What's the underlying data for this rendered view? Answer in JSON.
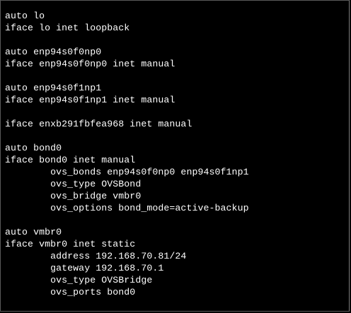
{
  "terminal": {
    "text_color": "#ffffff",
    "background_color": "#000000",
    "lines": [
      "auto lo",
      "iface lo inet loopback",
      "",
      "auto enp94s0f0np0",
      "iface enp94s0f0np0 inet manual",
      "",
      "auto enp94s0f1np1",
      "iface enp94s0f1np1 inet manual",
      "",
      "iface enxb291fbfea968 inet manual",
      "",
      "auto bond0",
      "iface bond0 inet manual",
      "        ovs_bonds enp94s0f0np0 enp94s0f1np1",
      "        ovs_type OVSBond",
      "        ovs_bridge vmbr0",
      "        ovs_options bond_mode=active-backup",
      "",
      "auto vmbr0",
      "iface vmbr0 inet static",
      "        address 192.168.70.81/24",
      "        gateway 192.168.70.1",
      "        ovs_type OVSBridge",
      "        ovs_ports bond0"
    ]
  }
}
